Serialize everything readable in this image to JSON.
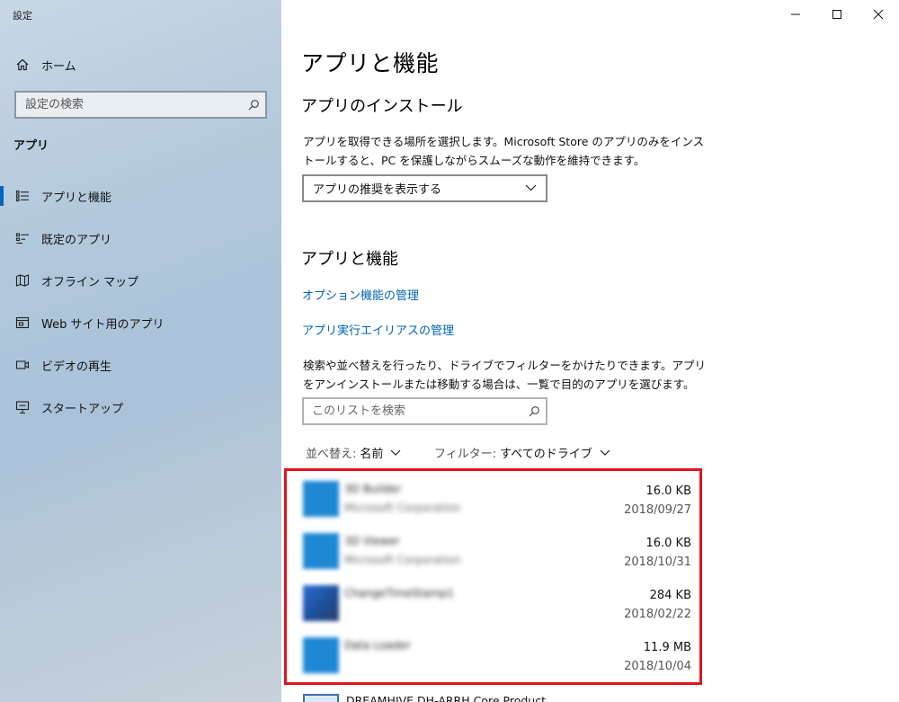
{
  "window": {
    "title": "設定",
    "minimize_icon": "minimize-icon",
    "maximize_icon": "maximize-icon",
    "close_icon": "close-icon"
  },
  "sidebar": {
    "home": {
      "label": "ホーム",
      "icon": "home-icon"
    },
    "search": {
      "placeholder": "設定の検索",
      "value": ""
    },
    "section": "アプリ",
    "items": [
      {
        "label": "アプリと機能",
        "icon": "apps-features-icon",
        "active": true
      },
      {
        "label": "既定のアプリ",
        "icon": "default-apps-icon",
        "active": false
      },
      {
        "label": "オフライン マップ",
        "icon": "offline-maps-icon",
        "active": false
      },
      {
        "label": "Web サイト用のアプリ",
        "icon": "apps-for-websites-icon",
        "active": false
      },
      {
        "label": "ビデオの再生",
        "icon": "video-playback-icon",
        "active": false
      },
      {
        "label": "スタートアップ",
        "icon": "startup-icon",
        "active": false
      }
    ]
  },
  "main": {
    "title": "アプリと機能",
    "install": {
      "heading": "アプリのインストール",
      "description": "アプリを取得できる場所を選択します。Microsoft Store のアプリのみをインストールすると、PC を保護しながらスムーズな動作を維持できます。",
      "dropdown_value": "アプリの推奨を表示する"
    },
    "features": {
      "heading": "アプリと機能",
      "link_optional": "オプション機能の管理",
      "link_alias": "アプリ実行エイリアスの管理",
      "description": "検索や並べ替えを行ったり、ドライブでフィルターをかけたりできます。アプリをアンインストールまたは移動する場合は、一覧で目的のアプリを選びます。",
      "search_placeholder": "このリストを検索",
      "sort_label": "並べ替え:",
      "sort_value": "名前",
      "filter_label": "フィルター:",
      "filter_value": "すべてのドライブ"
    },
    "apps": [
      {
        "name": "3D Builder",
        "publisher": "Microsoft Corporation",
        "size": "16.0 KB",
        "date": "2018/09/27",
        "color": "#1e88d4"
      },
      {
        "name": "3D Viewer",
        "publisher": "Microsoft Corporation",
        "size": "16.0 KB",
        "date": "2018/10/31",
        "color": "#1e88d4"
      },
      {
        "name": "ChangeTimeStamp1",
        "publisher": "",
        "size": "284 KB",
        "date": "2018/02/22",
        "color": "#2a5db0"
      },
      {
        "name": "Data Loader",
        "publisher": "",
        "size": "11.9 MB",
        "date": "2018/10/04",
        "color": "#1e88d4"
      }
    ],
    "partial_app": {
      "name": "DREAMHIVE DH-ARRH Core Product..."
    },
    "highlight_color": "#e0151b",
    "accent_color": "#0067c0"
  }
}
